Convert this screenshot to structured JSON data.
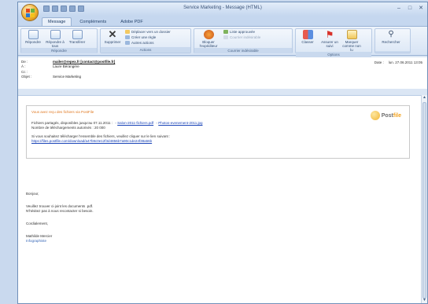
{
  "window": {
    "title": "Service Marketing - Message (HTML)"
  },
  "ribbon": {
    "tabs": [
      "Message",
      "Compléments",
      "Adobe PDF"
    ],
    "groups": [
      {
        "label": "Répondre",
        "buttons": [
          "Répondre",
          "Répondre à tous",
          "Transférer"
        ]
      },
      {
        "label": "Actions",
        "big": "Supprimer",
        "small": [
          "Déplacer vers un dossier",
          "Créer une règle",
          "Autres actions"
        ]
      },
      {
        "label": "Courrier indésirable",
        "big": "Bloquer l'expéditeur",
        "small": [
          "Liste approuvée",
          "Courrier indésirable"
        ]
      },
      {
        "label": "Options",
        "buttons": [
          "Classer",
          "Assurer un suivi",
          "Marquer comme non lu"
        ]
      },
      {
        "label": "",
        "buttons": [
          "Rechercher"
        ]
      }
    ]
  },
  "headers": {
    "from_label": "De :",
    "from_value": "mailer@repex.fr [contact@postfile.fr]",
    "to_label": "À :",
    "to_value": "Laure Bérangère",
    "cc_label": "Cc :",
    "cc_value": "",
    "subject_label": "Objet :",
    "subject_value": "Service Marketing",
    "date_label": "Date :",
    "date_value": "lun. 27.06.2011 13:05"
  },
  "notice": {
    "title": "Vous avez reçu des fichiers via PostFile",
    "line1_prefix": "Fichiers partagés, disponibles jusqu'au 07.11.2011 :",
    "file1": "Salon-2011-fichiers.pdf",
    "file2": "Photos-evenement-2011.jpg",
    "line2": "Nombre de téléchargements autorisés : 20 000",
    "line3": "Si vous souhaitez télécharger l'ensemble des fichiers, veuillez cliquer sur le lien suivant :",
    "link": "https://files.postfile.com/download/a47b9c0e12f3d4856b7a90c1de24f38a56b",
    "logo_text_a": "Post",
    "logo_text_b": "file"
  },
  "message": {
    "greeting": "Bonjour,",
    "line1": "Veuillez trouver ci-joint les documents .pdf.",
    "line2": "N'hésitez pas à nous recontacter si besoin.",
    "closing": "Cordialement,",
    "sign_name": "Mathilde Mercier",
    "sign_role": "Infographiste"
  },
  "colors": {
    "accent_orange": "#e07820",
    "link_blue": "#1a44b8",
    "ribbon_blue": "#c5d7ef"
  }
}
